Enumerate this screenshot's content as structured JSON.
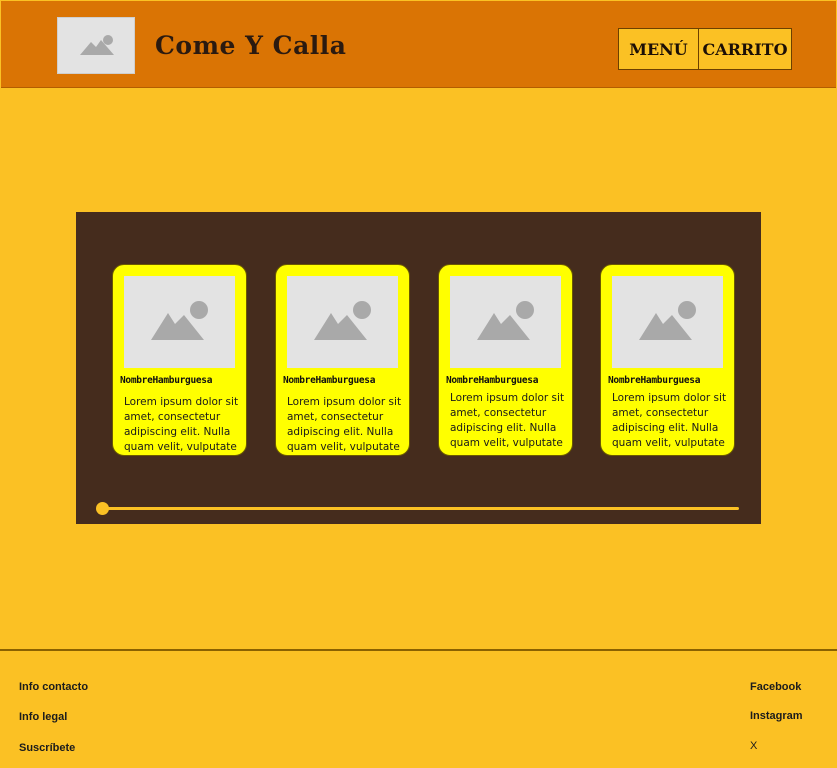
{
  "header": {
    "brand": "Come Y Calla",
    "nav": {
      "menu": "MENÚ",
      "cart": "CARRITO"
    }
  },
  "carousel": {
    "cards": [
      {
        "title": "NombreHamburguesa",
        "description": "Lorem ipsum dolor sit amet, consectetur adipiscing elit. Nulla quam velit, vulputate"
      },
      {
        "title": "NombreHamburguesa",
        "description": "Lorem ipsum dolor sit amet, consectetur adipiscing elit. Nulla quam velit, vulputate"
      },
      {
        "title": "NombreHamburguesa",
        "description": "Lorem ipsum dolor sit amet, consectetur adipiscing elit. Nulla quam velit, vulputate"
      },
      {
        "title": "NombreHamburguesa",
        "description": "Lorem ipsum dolor sit amet, consectetur adipiscing elit. Nulla quam velit, vulputate"
      }
    ],
    "scroll_position": 0
  },
  "footer": {
    "left": [
      "Info contacto",
      "Info legal",
      "Suscríbete"
    ],
    "right": [
      "Facebook",
      "Instagram",
      "X"
    ]
  },
  "colors": {
    "header_bg": "#da7404",
    "page_bg": "#fbc124",
    "carousel_bg": "#452c1d",
    "card_bg": "#ffff00"
  },
  "icons": {
    "logo": "image-placeholder-icon",
    "card_image": "image-placeholder-icon"
  }
}
